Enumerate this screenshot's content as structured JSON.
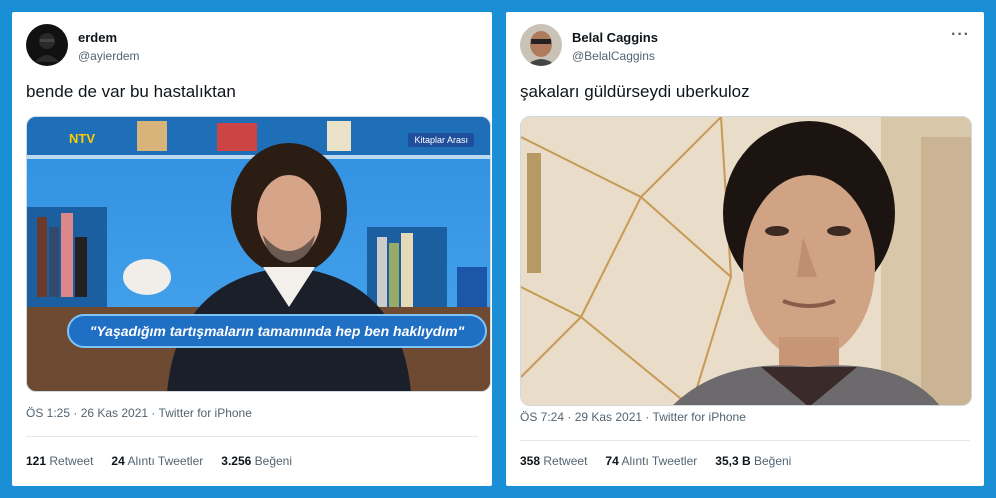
{
  "tweets": [
    {
      "name": "erdem",
      "handle": "@ayierdem",
      "text": "bende de var bu hastalıktan",
      "media": {
        "channel_logo": "NTV",
        "program_tag": "Kitaplar Arası",
        "caption": "\"Yaşadığım tartışmaların tamamında hep ben haklıydım\""
      },
      "meta": "ÖS 1:25 · 26 Kas 2021 · Twitter for iPhone",
      "stats": {
        "retweets": "121",
        "retweets_label": "Retweet",
        "quotes": "24",
        "quotes_label": "Alıntı Tweetler",
        "likes": "3.256",
        "likes_label": "Beğeni"
      }
    },
    {
      "name": "Belal Caggins",
      "handle": "@BelalCaggins",
      "text": "şakaları güldürseydi uberkuloz",
      "more": "···",
      "meta": "ÖS 7:24 · 29 Kas 2021 · Twitter for iPhone",
      "stats": {
        "retweets": "358",
        "retweets_label": "Retweet",
        "quotes": "74",
        "quotes_label": "Alıntı Tweetler",
        "likes": "35,3 B",
        "likes_label": "Beğeni"
      }
    }
  ],
  "colors": {
    "background": "#1a8fd6",
    "text": "#0f1419",
    "secondary": "#536471"
  }
}
